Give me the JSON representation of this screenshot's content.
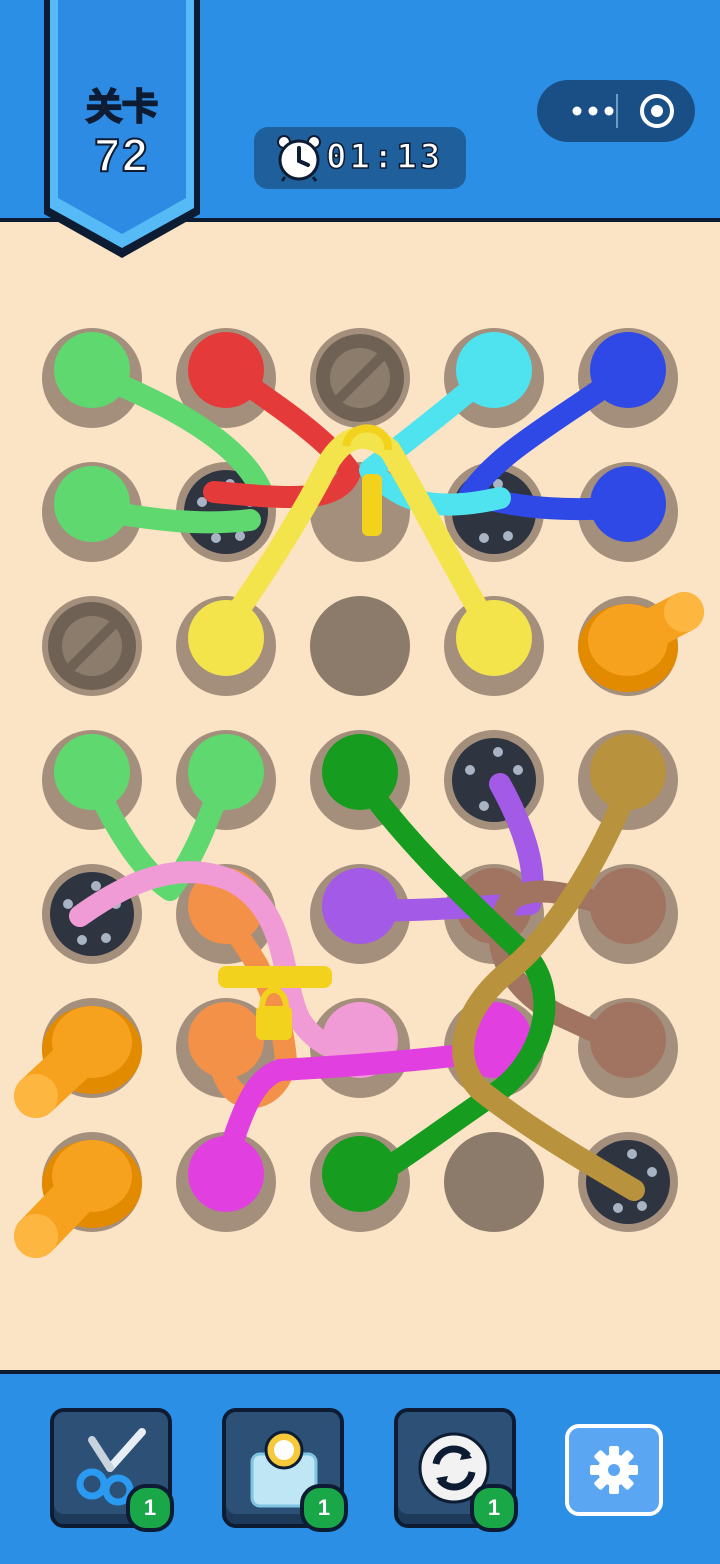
{
  "header": {
    "level_label": "关卡",
    "level_number": "72",
    "timer": "01:13",
    "capsule": {
      "more_icon": "more-dots-icon",
      "close_icon": "target-close-icon"
    }
  },
  "tools": [
    {
      "name": "scissors",
      "icon": "scissors-icon",
      "count": "1"
    },
    {
      "name": "freeze",
      "icon": "ice-cube-timer-icon",
      "count": "1"
    },
    {
      "name": "shuffle",
      "icon": "refresh-icon",
      "count": "1"
    }
  ],
  "settings": {
    "icon": "gear-icon"
  },
  "colors": {
    "header_blue": "#2b8fe6",
    "board_bg": "#fbe4c5",
    "green": "#5fd86f",
    "red": "#e53a3a",
    "cyan": "#4ee3ef",
    "blue": "#2f49e6",
    "yellow": "#f3e44b",
    "orange": "#f7a21e",
    "dark_green": "#169c1e",
    "purple": "#a35ae6",
    "brown": "#a07460",
    "gold": "#b8923c",
    "pink": "#f09ad6",
    "magenta": "#e13fe0",
    "peach": "#f39148"
  }
}
